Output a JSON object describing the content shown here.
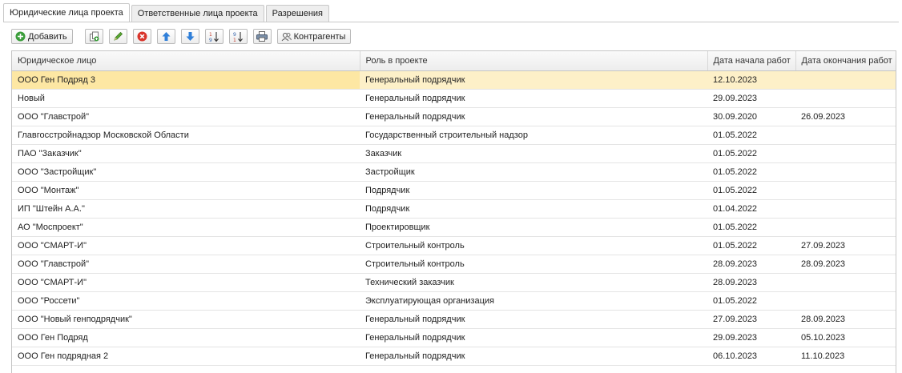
{
  "tabs": [
    {
      "label": "Юридические лица проекта",
      "active": true
    },
    {
      "label": "Ответственные лица проекта",
      "active": false
    },
    {
      "label": "Разрешения",
      "active": false
    }
  ],
  "toolbar": {
    "add_label": "Добавить",
    "counterparties_label": "Контрагенты",
    "icons": [
      "add-icon",
      "copy-icon",
      "edit-icon",
      "delete-icon",
      "move-up-icon",
      "move-down-icon",
      "sort-asc-icon",
      "sort-desc-icon",
      "print-icon",
      "counterparties-icon"
    ]
  },
  "colors": {
    "selected_row": "#fde7a3",
    "selected_row_rest": "#fdf0c8",
    "add_green": "#3a9d3a",
    "delete_red": "#d9342b",
    "arrow_blue": "#2f7fd9"
  },
  "table": {
    "columns": [
      "Юридическое лицо",
      "Роль в проекте",
      "Дата начала работ",
      "Дата окончания работ"
    ],
    "rows": [
      [
        "ООО Ген Подряд 3",
        "Генеральный подрядчик",
        "12.10.2023",
        ""
      ],
      [
        "Новый",
        "Генеральный подрядчик",
        "29.09.2023",
        ""
      ],
      [
        "ООО \"Главстрой\"",
        "Генеральный подрядчик",
        "30.09.2020",
        "26.09.2023"
      ],
      [
        "Главгосстройнадзор Московской Области",
        "Государственный строительный надзор",
        "01.05.2022",
        ""
      ],
      [
        "ПАО \"Заказчик\"",
        "Заказчик",
        "01.05.2022",
        ""
      ],
      [
        "ООО \"Застройщик\"",
        "Застройщик",
        "01.05.2022",
        ""
      ],
      [
        "ООО \"Монтаж\"",
        "Подрядчик",
        "01.05.2022",
        ""
      ],
      [
        "ИП \"Штейн А.А.\"",
        "Подрядчик",
        "01.04.2022",
        ""
      ],
      [
        "АО \"Моспроект\"",
        "Проектировщик",
        "01.05.2022",
        ""
      ],
      [
        "ООО \"СМАРТ-И\"",
        "Строительный контроль",
        "01.05.2022",
        "27.09.2023"
      ],
      [
        "ООО \"Главстрой\"",
        "Строительный контроль",
        "28.09.2023",
        "28.09.2023"
      ],
      [
        "ООО \"СМАРТ-И\"",
        "Технический заказчик",
        "28.09.2023",
        ""
      ],
      [
        "ООО \"Россети\"",
        "Эксплуатирующая организация",
        "01.05.2022",
        ""
      ],
      [
        "ООО \"Новый генподрядчик\"",
        "Генеральный подрядчик",
        "27.09.2023",
        "28.09.2023"
      ],
      [
        "ООО Ген Подряд",
        "Генеральный подрядчик",
        "29.09.2023",
        "05.10.2023"
      ],
      [
        "ООО Ген подрядная 2",
        "Генеральный подрядчик",
        "06.10.2023",
        "11.10.2023"
      ]
    ],
    "selected_row": 0
  }
}
